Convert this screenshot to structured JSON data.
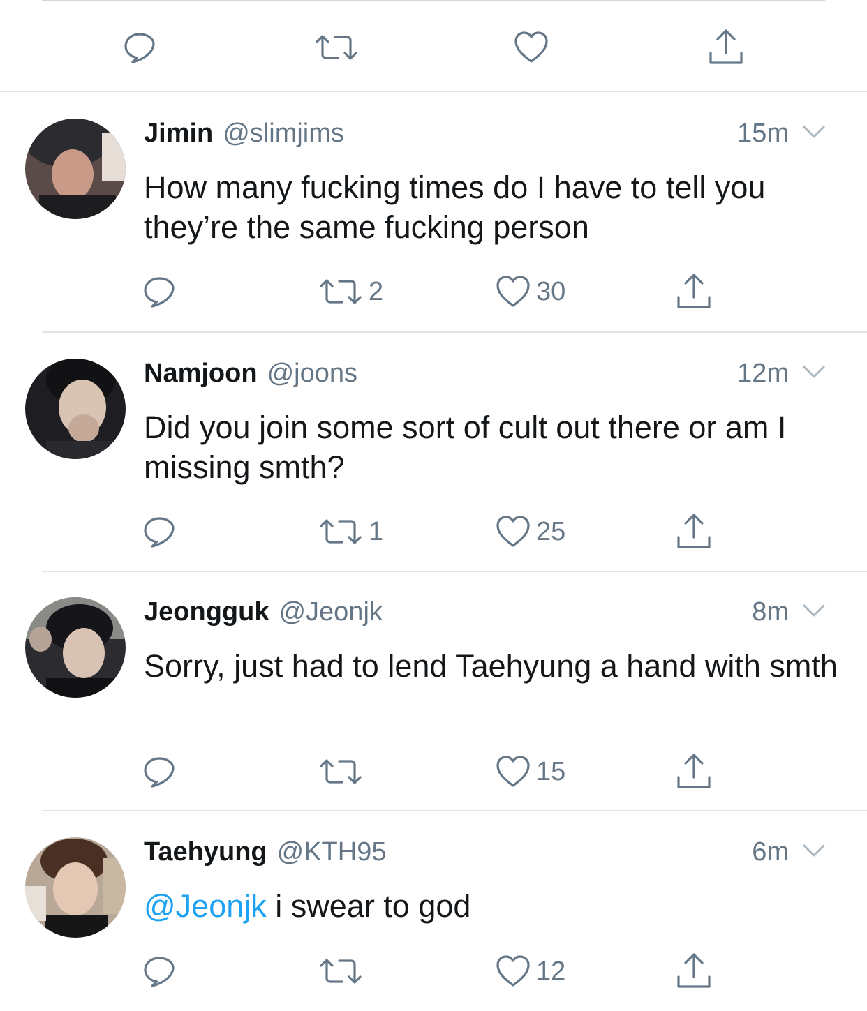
{
  "top_actions": {
    "reply_icon": "reply-icon",
    "retweet_icon": "retweet-icon",
    "like_icon": "heart-icon",
    "share_icon": "share-icon"
  },
  "tweets": [
    {
      "name": "Jimin",
      "handle": "@slimjims",
      "time": "15m",
      "text": "How many fucking times do I have to tell you they’re the same fucking person",
      "mention": "",
      "retweets": "2",
      "likes": "30"
    },
    {
      "name": "Namjoon",
      "handle": "@joons",
      "time": "12m",
      "text": "Did you join some sort of cult out there or am I missing smth?",
      "mention": "",
      "retweets": "1",
      "likes": "25"
    },
    {
      "name": "Jeongguk",
      "handle": "@Jeonjk",
      "time": "8m",
      "text": "Sorry, just had to lend Taehyung a hand with smth",
      "mention": "",
      "retweets": "",
      "likes": "15"
    },
    {
      "name": "Taehyung",
      "handle": "@KTH95",
      "time": "6m",
      "text": " i swear to god",
      "mention": "@Jeonjk",
      "retweets": "",
      "likes": "12"
    }
  ],
  "colors": {
    "text": "#14171a",
    "secondary": "#657786",
    "link": "#1da1f2",
    "divider": "#dfe4e8"
  }
}
